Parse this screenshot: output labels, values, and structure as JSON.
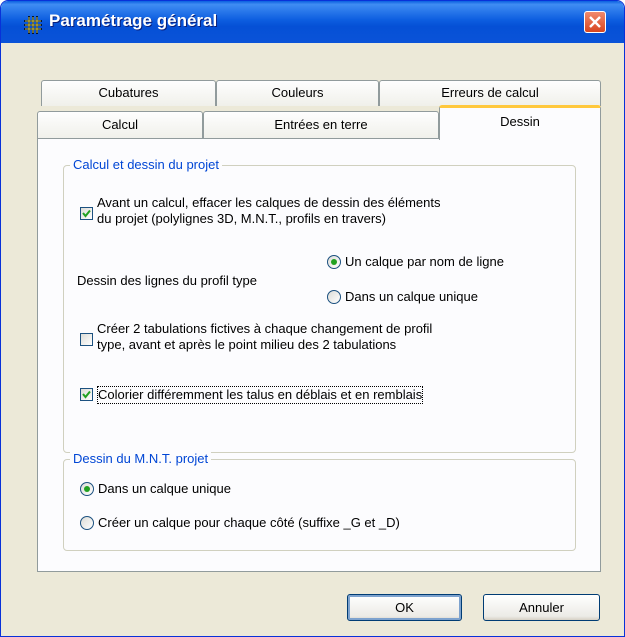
{
  "window": {
    "title": "Paramétrage général",
    "icon": "grid-icon",
    "close_icon": "close-icon"
  },
  "tabs": {
    "row_back": [
      "Cubatures",
      "Couleurs",
      "Erreurs de calcul"
    ],
    "row_front": [
      "Calcul",
      "Entrées en terre",
      "Dessin"
    ],
    "active": "Dessin"
  },
  "group_projet": {
    "legend": "Calcul et dessin du projet",
    "opt_effacer": {
      "line1": "Avant un calcul, effacer les calques de dessin des éléments",
      "line2": "du projet (polylignes 3D, M.N.T., profils en travers)",
      "checked": true
    },
    "lignes_label": "Dessin des lignes du profil type",
    "radio_nom": {
      "label": "Un calque par nom de ligne",
      "selected": true
    },
    "radio_unique": {
      "label": "Dans un calque unique",
      "selected": false
    },
    "opt_tabulations": {
      "line1": "Créer 2 tabulations fictives à chaque changement de profil",
      "line2": "type, avant et après le point milieu des 2 tabulations",
      "checked": false
    },
    "opt_colorier": {
      "label": "Colorier différemment les talus en déblais et en remblais",
      "checked": true
    }
  },
  "group_mnt": {
    "legend": "Dessin du M.N.T. projet",
    "radio_unique": {
      "label": "Dans un calque unique",
      "selected": true
    },
    "radio_cote": {
      "label": "Créer un calque pour chaque côté (suffixe _G et _D)",
      "selected": false
    }
  },
  "buttons": {
    "ok": "OK",
    "cancel": "Annuler"
  },
  "colors": {
    "title_bar": "#0a53d8",
    "legend": "#0046d5",
    "active_tab_accent": "#ffc83c",
    "check": "#21a121"
  }
}
